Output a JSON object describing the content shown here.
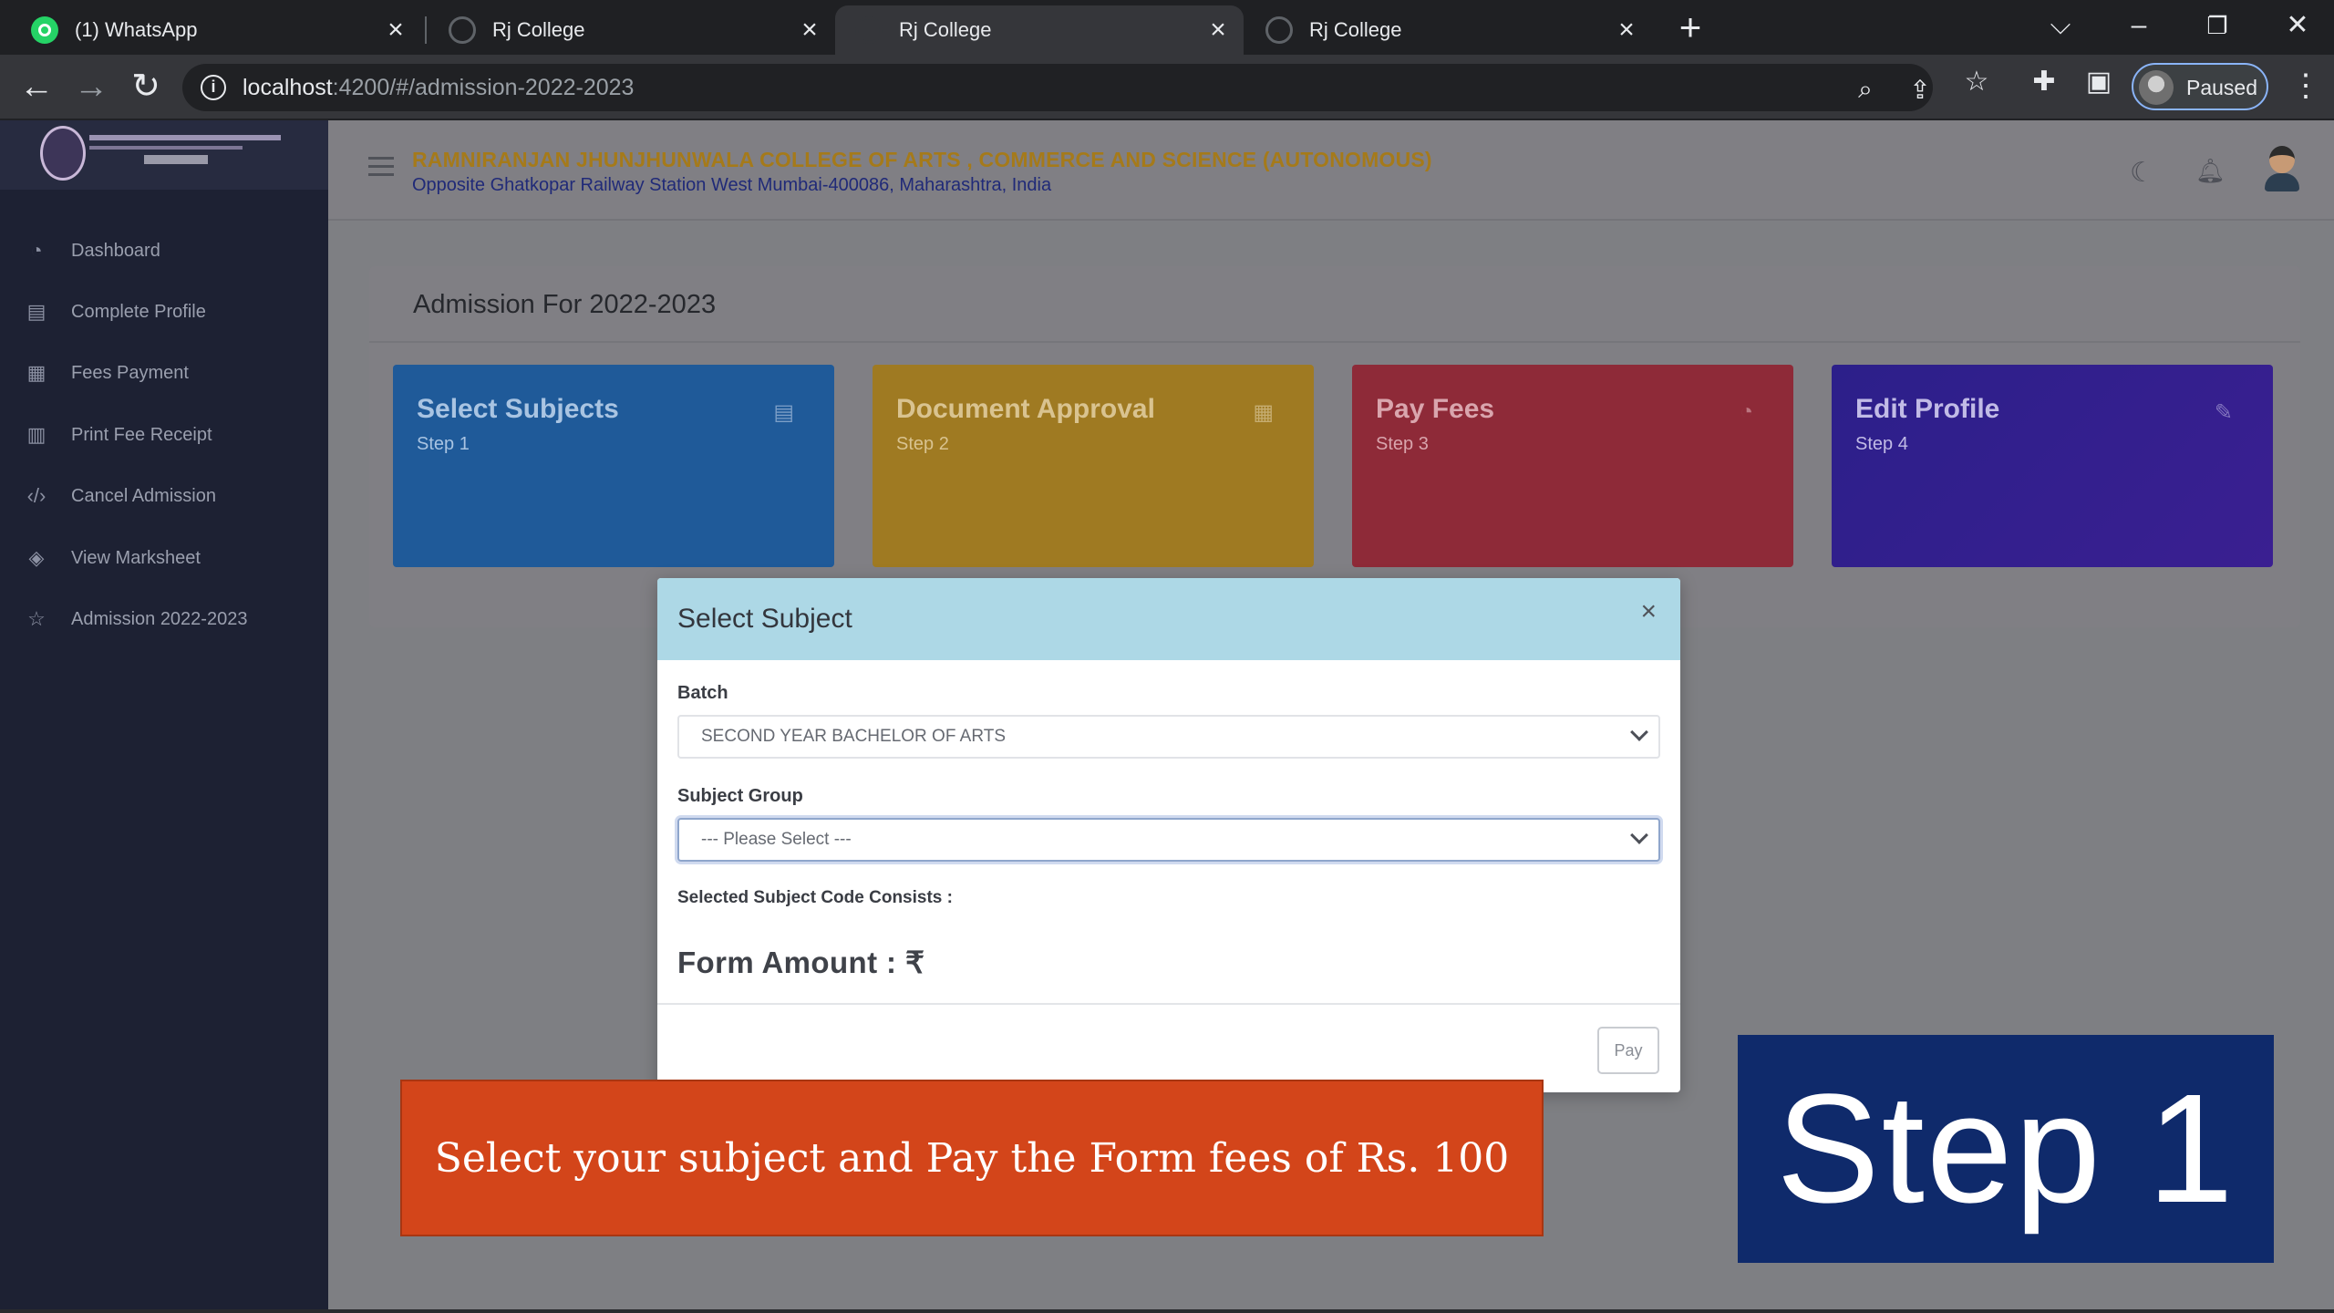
{
  "browser": {
    "tabs": [
      {
        "title": "(1) WhatsApp",
        "icon": "whatsapp-icon",
        "active": false
      },
      {
        "title": "Rj College",
        "icon": "globe-icon",
        "active": false
      },
      {
        "title": "Rj College",
        "icon": "globe-icon",
        "active": true
      },
      {
        "title": "Rj College",
        "icon": "globe-icon",
        "active": false
      }
    ],
    "url_host": "localhost",
    "url_path": ":4200/#/admission-2022-2023",
    "profile_label": "Paused"
  },
  "sidebar": {
    "items": [
      {
        "label": "Dashboard",
        "icon": "gauge-icon"
      },
      {
        "label": "Complete Profile",
        "icon": "document-icon"
      },
      {
        "label": "Fees Payment",
        "icon": "table-icon"
      },
      {
        "label": "Print Fee Receipt",
        "icon": "receipt-icon"
      },
      {
        "label": "Cancel Admission",
        "icon": "code-icon"
      },
      {
        "label": "View Marksheet",
        "icon": "layers-icon"
      },
      {
        "label": "Admission 2022-2023",
        "icon": "star-icon"
      }
    ]
  },
  "header": {
    "college_name": "RAMNIRANJAN JHUNJHUNWALA COLLEGE OF ARTS , COMMERCE AND SCIENCE (AUTONOMOUS)",
    "college_address": "Opposite Ghatkopar Railway Station West Mumbai-400086, Maharashtra, India"
  },
  "main": {
    "title": "Admission For 2022-2023",
    "steps": [
      {
        "title": "Select Subjects",
        "sub": "Step 1",
        "color": "#1f6fc0",
        "icon": "file-icon"
      },
      {
        "title": "Document Approval",
        "sub": "Step 2",
        "color": "#c9961a",
        "icon": "table-icon"
      },
      {
        "title": "Pay Fees",
        "sub": "Step 3",
        "color": "#b3283a",
        "icon": "gauge-icon"
      },
      {
        "title": "Edit Profile",
        "sub": "Step 4",
        "color": "#2a1a9a",
        "icon": "pencil-icon"
      }
    ]
  },
  "modal": {
    "title": "Select Subject",
    "close": "×",
    "batch_label": "Batch",
    "batch_value": "SECOND YEAR BACHELOR OF ARTS",
    "subject_group_label": "Subject Group",
    "subject_group_value": "--- Please Select ---",
    "subject_code_label": "Selected Subject Code Consists :",
    "form_amount": "Form Amount : ₹",
    "pay_label": "Pay"
  },
  "overlay": {
    "banner_text": "Select your subject and Pay the Form fees of Rs. 100",
    "step_badge": "Step 1"
  }
}
